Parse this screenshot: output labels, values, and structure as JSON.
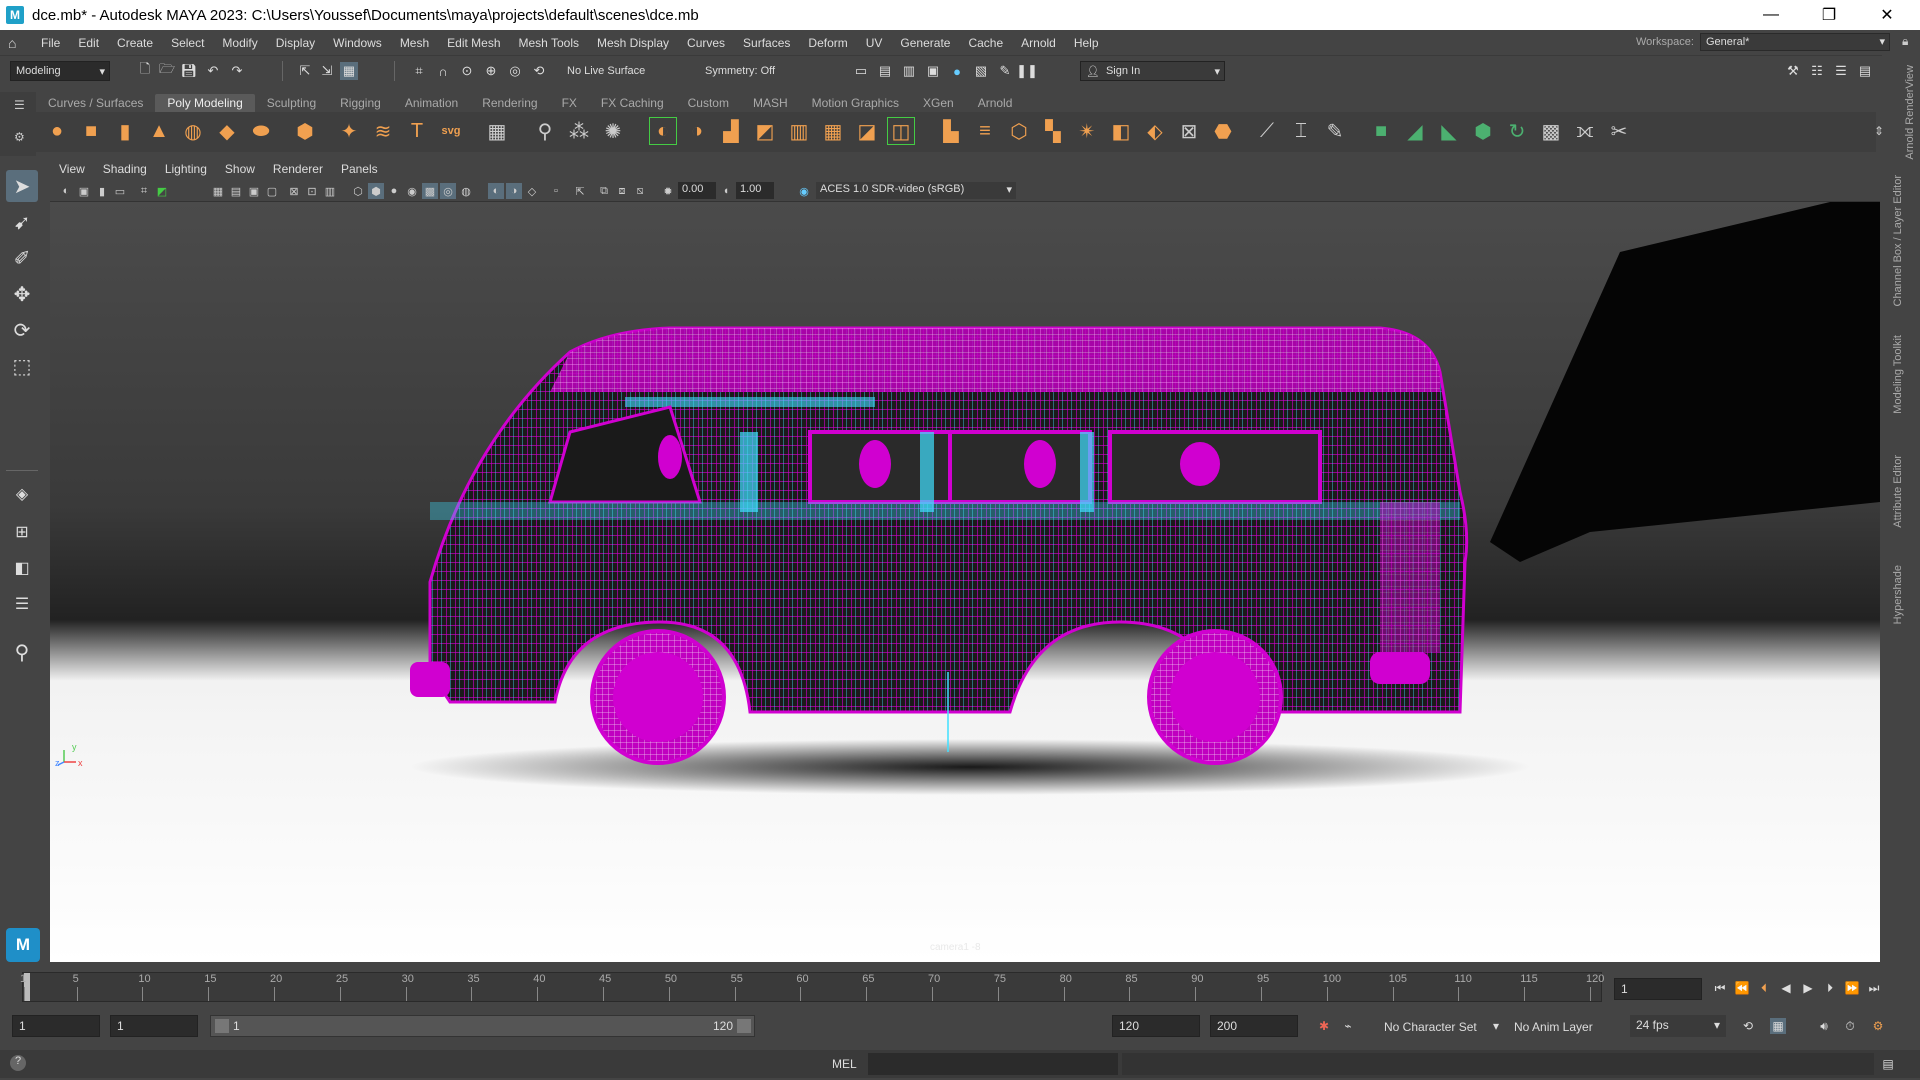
{
  "window": {
    "title": "dce.mb* - Autodesk MAYA 2023: C:\\Users\\Youssef\\Documents\\maya\\projects\\default\\scenes\\dce.mb",
    "app_icon": "M",
    "minimize": "—",
    "maximize": "❐",
    "close": "✕"
  },
  "menu": [
    "File",
    "Edit",
    "Create",
    "Select",
    "Modify",
    "Display",
    "Windows",
    "Mesh",
    "Edit Mesh",
    "Mesh Tools",
    "Mesh Display",
    "Curves",
    "Surfaces",
    "Deform",
    "UV",
    "Generate",
    "Cache",
    "Arnold",
    "Help"
  ],
  "workspace": {
    "label": "Workspace:",
    "value": "General*"
  },
  "statusline": {
    "mode": "Modeling",
    "live_surface": "No Live Surface",
    "symmetry": "Symmetry: Off",
    "sign_in": "Sign In"
  },
  "shelf_tabs": [
    {
      "label": "Curves / Surfaces",
      "active": false
    },
    {
      "label": "Poly Modeling",
      "active": true
    },
    {
      "label": "Sculpting",
      "active": false
    },
    {
      "label": "Rigging",
      "active": false
    },
    {
      "label": "Animation",
      "active": false
    },
    {
      "label": "Rendering",
      "active": false
    },
    {
      "label": "FX",
      "active": false
    },
    {
      "label": "FX Caching",
      "active": false
    },
    {
      "label": "Custom",
      "active": false
    },
    {
      "label": "MASH",
      "active": false
    },
    {
      "label": "Motion Graphics",
      "active": false
    },
    {
      "label": "XGen",
      "active": false
    },
    {
      "label": "Arnold",
      "active": false
    }
  ],
  "panel_menu": [
    "View",
    "Shading",
    "Lighting",
    "Show",
    "Renderer",
    "Panels"
  ],
  "panel_toolbar": {
    "exposure": "0.00",
    "gamma": "1.00",
    "color_space": "ACES 1.0 SDR-video (sRGB)"
  },
  "viewport": {
    "camera_label": "camera1 -8",
    "axis_y": "y",
    "axis_z": "z",
    "axis_x": "x"
  },
  "right_dock_tabs": [
    "Arnold RenderView",
    "Channel Box / Layer Editor",
    "Modeling Toolkit",
    "Attribute Editor",
    "Hypershade"
  ],
  "timeline": {
    "ticks": [
      "1",
      "5",
      "10",
      "15",
      "20",
      "25",
      "30",
      "35",
      "40",
      "45",
      "50",
      "55",
      "60",
      "65",
      "70",
      "75",
      "80",
      "85",
      "90",
      "95",
      "100",
      "105",
      "110",
      "115",
      "120"
    ],
    "current_frame": "1"
  },
  "range": {
    "start": "1",
    "playback_start": "1",
    "slider_start": "1",
    "slider_end": "120",
    "playback_end": "120",
    "end": "200",
    "character_set": "No Character Set",
    "anim_layer": "No Anim Layer",
    "fps": "24 fps"
  },
  "command_line": {
    "language": "MEL"
  },
  "colors": {
    "wire_magenta": "#d000d0",
    "wire_cyan": "#40e0ff",
    "accent": "#f0a050"
  }
}
